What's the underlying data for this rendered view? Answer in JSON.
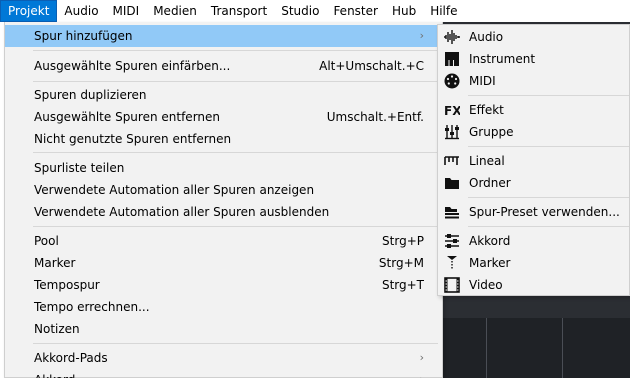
{
  "menubar": {
    "items": [
      "Projekt",
      "Audio",
      "MIDI",
      "Medien",
      "Transport",
      "Studio",
      "Fenster",
      "Hub",
      "Hilfe"
    ],
    "active": "Projekt"
  },
  "menu": {
    "items": [
      {
        "label": "Spur hinzufügen",
        "shortcut": "",
        "arrow": "›"
      },
      {
        "label": "Ausgewählte Spuren einfärben...",
        "shortcut": "Alt+Umschalt.+C"
      },
      {
        "label": "Spuren duplizieren",
        "shortcut": ""
      },
      {
        "label": "Ausgewählte Spuren entfernen",
        "shortcut": "Umschalt.+Entf."
      },
      {
        "label": "Nicht genutzte Spuren entfernen",
        "shortcut": ""
      },
      {
        "label": "Spurliste teilen",
        "shortcut": ""
      },
      {
        "label": "Verwendete Automation aller Spuren anzeigen",
        "shortcut": ""
      },
      {
        "label": "Verwendete Automation aller Spuren ausblenden",
        "shortcut": ""
      },
      {
        "label": "Pool",
        "shortcut": "Strg+P"
      },
      {
        "label": "Marker",
        "shortcut": "Strg+M"
      },
      {
        "label": "Tempospur",
        "shortcut": "Strg+T"
      },
      {
        "label": "Tempo errechnen...",
        "shortcut": ""
      },
      {
        "label": "Notizen",
        "shortcut": ""
      },
      {
        "label": "Akkord-Pads",
        "shortcut": "",
        "arrow": "›"
      },
      {
        "label": "Akkord...",
        "shortcut": "",
        "arrow": "›"
      }
    ]
  },
  "submenu": {
    "items": [
      {
        "label": "Audio",
        "icon": "audio-waveform-icon"
      },
      {
        "label": "Instrument",
        "icon": "piano-keys-icon"
      },
      {
        "label": "MIDI",
        "icon": "midi-connector-icon"
      },
      {
        "label": "Effekt",
        "icon": "fx-icon"
      },
      {
        "label": "Gruppe",
        "icon": "group-faders-icon"
      },
      {
        "label": "Lineal",
        "icon": "ruler-icon"
      },
      {
        "label": "Ordner",
        "icon": "folder-icon"
      },
      {
        "label": "Spur-Preset verwenden...",
        "icon": "track-preset-icon"
      },
      {
        "label": "Akkord",
        "icon": "chord-icon"
      },
      {
        "label": "Marker",
        "icon": "marker-icon"
      },
      {
        "label": "Video",
        "icon": "video-film-icon"
      }
    ]
  },
  "colors": {
    "accent": "#0078d7",
    "highlight": "#91c9f7",
    "menu_bg": "#f2f2f2"
  }
}
